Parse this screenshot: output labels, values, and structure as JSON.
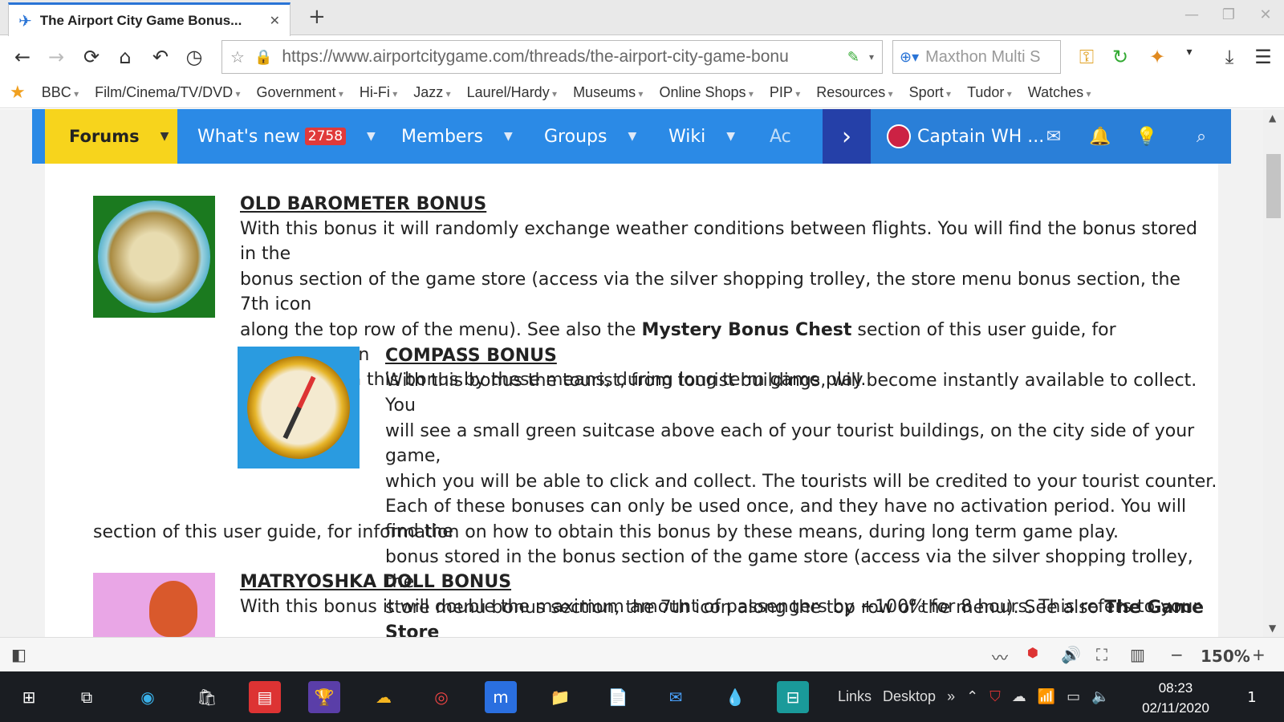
{
  "browser": {
    "tab_title": "The Airport City Game Bonus...",
    "tab_close": "✕",
    "new_tab": "+",
    "url": "https://www.airportcitygame.com/threads/the-airport-city-game-bonu",
    "search_placeholder": "Maxthon Multi S"
  },
  "bookmarks": [
    "BBC",
    "Film/Cinema/TV/DVD",
    "Government",
    "Hi-Fi",
    "Jazz",
    "Laurel/Hardy",
    "Museums",
    "Online Shops",
    "PIP",
    "Resources",
    "Sport",
    "Tudor",
    "Watches"
  ],
  "forum_nav": {
    "forums": "Forums",
    "whats_new": "What's new",
    "whats_new_count": "2758",
    "members": "Members",
    "groups": "Groups",
    "wiki": "Wiki",
    "more": "Ac",
    "user": "Captain WH ..."
  },
  "sections": [
    {
      "title": "OLD BAROMETER BONUS",
      "text_html": "With this bonus it will randomly exchange weather conditions between flights. You will find the bonus stored in the<br>bonus section of the game store (access via the silver shopping trolley, the store menu bonus section, the 7th icon<br>along the top row of the menu). See also the <b>Mystery Bonus Chest</b> section of this user guide, for information on<br>how to obtain this bonus by these means, during long term game play."
    },
    {
      "title": "COMPASS BONUS",
      "text_html": "With this bonus the tourist, from tourist buildings, will become instantly available to collect. You<br>will see a small green suitcase above each of your tourist buildings, on the city side of your game,<br>which you will be able to click and collect. The tourists will be credited to your tourist counter.<br>Each of these bonuses can only be used once, and they have no activation period. You will find the<br>bonus stored in the bonus section of the game store (access via the silver shopping trolley, the<br>store menu bonus section, the 7th icon along the top row of the menu). See also <b>The Game Store</b>",
      "tail": "section of this user guide, for information on how to obtain this bonus by these means, during long term game play."
    },
    {
      "title": "MATRYOSHKA DOLL BONUS",
      "text": "With this bonus it will double the maximum amount of passengers by +100% for 8 hours. This refers to your"
    }
  ],
  "statusbar": {
    "zoom": "150%",
    "minus": "−",
    "plus": "+"
  },
  "taskbar": {
    "links": "Links",
    "desktop": "Desktop",
    "time": "08:23",
    "date": "02/11/2020",
    "notifications": "1"
  }
}
